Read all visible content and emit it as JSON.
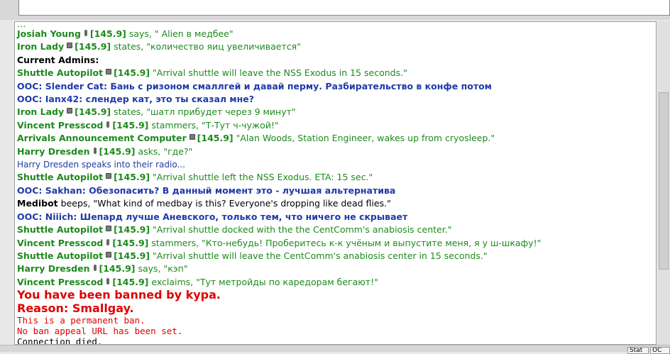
{
  "chat": {
    "cut_line": "…",
    "messages": [
      {
        "kind": "radio-mic",
        "speaker": "Josiah Young",
        "freq": "[145.9]",
        "text": "says, \" Alien в медбее\""
      },
      {
        "kind": "radio-box",
        "speaker": "Iron Lady",
        "freq": "[145.9]",
        "text": "states, \"количество яиц увеличивается\""
      },
      {
        "kind": "admins",
        "text": "Current Admins:"
      },
      {
        "kind": "radio-box",
        "speaker": "Shuttle Autopilot",
        "freq": "[145.9]",
        "text": "\"Arrival shuttle will leave the NSS Exodus in 15 seconds.\""
      },
      {
        "kind": "ooc",
        "text": "OOC: Slender Cat: Бань с ризоном смаллгей и давай перму. Разбирательство в конфе потом"
      },
      {
        "kind": "ooc",
        "text": "OOC: Ianx42: слендер кат, это ты сказал мне?"
      },
      {
        "kind": "radio-box",
        "speaker": "Iron Lady",
        "freq": "[145.9]",
        "text": "states, \"шатл прибудет через 9 минут\""
      },
      {
        "kind": "radio-mic",
        "speaker": "Vincent Presscod",
        "freq": "[145.9]",
        "text": "stammers, \"Т-Тут ч-чужой!\""
      },
      {
        "kind": "radio-box",
        "speaker": "Arrivals Announcement Computer",
        "freq": "[145.9]",
        "text": "\"Alan Woods, Station Engineer, wakes up from cryosleep.\""
      },
      {
        "kind": "radio-mic",
        "speaker": "Harry Dresden",
        "freq": "[145.9]",
        "text": "asks, \"где?\""
      },
      {
        "kind": "emote",
        "text": "Harry Dresden speaks into their radio..."
      },
      {
        "kind": "radio-box",
        "speaker": "Shuttle Autopilot",
        "freq": "[145.9]",
        "text": "\"Arrival shuttle left the NSS Exodus. ETA: 15 sec.\""
      },
      {
        "kind": "ooc",
        "text": "OOC: Sakhan: Обезопасить? В данный момент это - лучшая альтернатива"
      },
      {
        "kind": "say",
        "speaker": "Medibot",
        "text": "beeps, \"What kind of medbay is this? Everyone's dropping like dead flies.\""
      },
      {
        "kind": "ooc",
        "text": "OOC: Niiich: Шепард лучше Аневского, только тем, что ничего не скрывает"
      },
      {
        "kind": "radio-box",
        "speaker": "Shuttle Autopilot",
        "freq": "[145.9]",
        "text": "\"Arrival shuttle docked with the the CentComm's anabiosis center.\""
      },
      {
        "kind": "radio-mic",
        "speaker": "Vincent Presscod",
        "freq": "[145.9]",
        "text": "stammers, \"Кто-небудь! Проберитесь к-к учёным и выпустите меня, я у ш-шкафу!\""
      },
      {
        "kind": "radio-box",
        "speaker": "Shuttle Autopilot",
        "freq": "[145.9]",
        "text": "\"Arrival shuttle will leave the CentComm's anabiosis center in 15 seconds.\""
      },
      {
        "kind": "radio-mic",
        "speaker": "Harry Dresden",
        "freq": "[145.9]",
        "text": "says, \"кэп\""
      },
      {
        "kind": "radio-mic",
        "speaker": "Vincent Presscod",
        "freq": "[145.9]",
        "text": "exclaims, \"Тут метройды по каредорам бегают!\""
      }
    ],
    "ban_title": "You have been banned by kypa.",
    "ban_reason": "Reason: Smallgay.",
    "ban_permanent": "This is a permanent ban.",
    "ban_appeal": "No ban appeal URL has been set.",
    "connection": "Connection died."
  },
  "bottom": {
    "btn1": "Stat",
    "btn2": "OC"
  },
  "colors": {
    "radio_green": "#1d8a1d",
    "ooc_blue": "#1f3aa8",
    "ban_red": "#e00000"
  }
}
